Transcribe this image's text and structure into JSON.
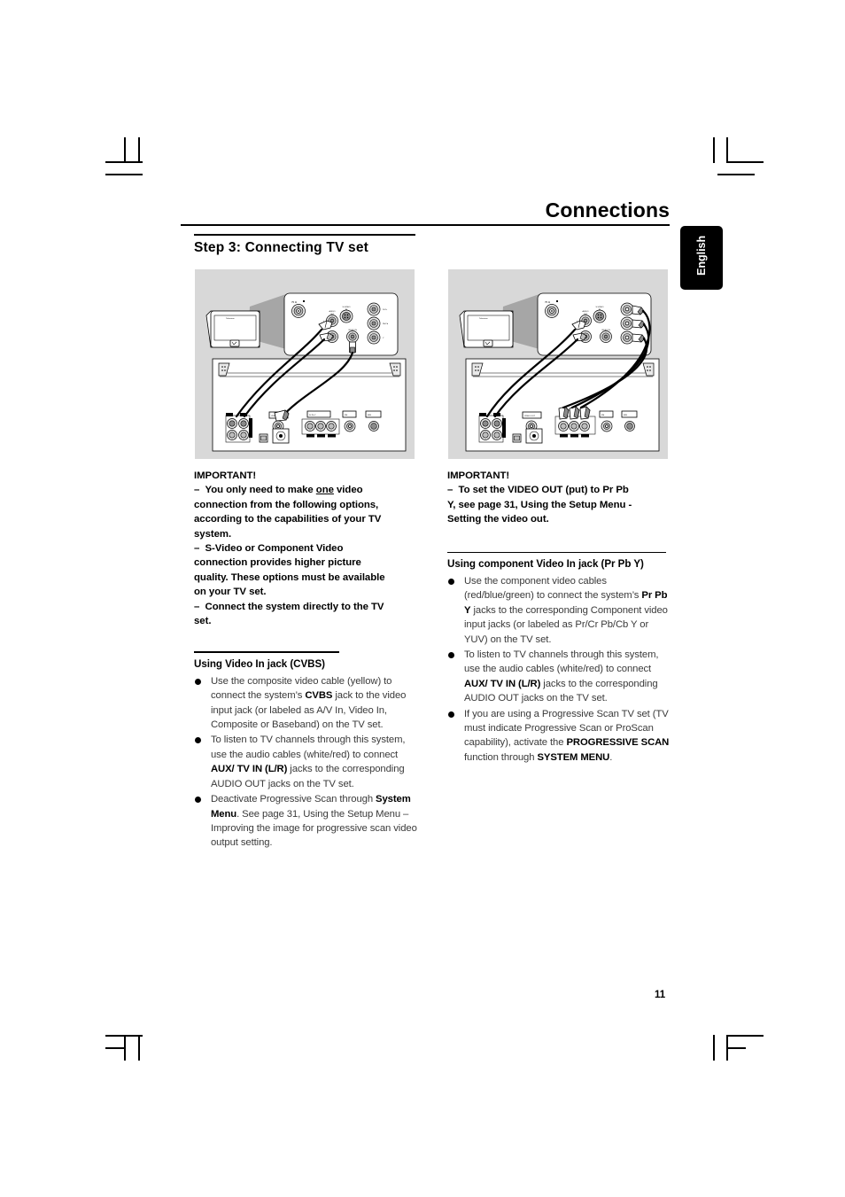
{
  "page": {
    "title": "Connections",
    "number": "11",
    "side_tab": "English",
    "step_heading": "Step 3:  Connecting TV set"
  },
  "left_column": {
    "important_label": "IMPORTANT!",
    "important_lines": [
      "–  You only need to make one video",
      "connection from the following options,",
      "according to the capabilities of your TV",
      "system.",
      "–  S-Video or Component Video",
      "connection provides higher picture",
      "quality. These options must be available",
      "on your TV set.",
      "–  Connect the system directly to the TV",
      "set."
    ],
    "section_heading": "Using Video In jack (CVBS)",
    "bullets": [
      {
        "parts": [
          {
            "t": "Use the composite video cable (yellow) to connect the system’s ",
            "b": false
          },
          {
            "t": "CVBS",
            "b": true
          },
          {
            "t": " jack to the video input jack (or labeled as A/V In, Video In, Composite or Baseband) on the TV set.",
            "b": false
          }
        ]
      },
      {
        "parts": [
          {
            "t": "To listen to TV channels through this system, use the audio cables (white/red) to connect ",
            "b": false
          },
          {
            "t": "AUX/ TV IN (L/R)",
            "b": true
          },
          {
            "t": " jacks to the corresponding AUDIO OUT jacks on the TV set.",
            "b": false
          }
        ]
      },
      {
        "parts": [
          {
            "t": "Deactivate Progressive Scan through ",
            "b": false
          },
          {
            "t": "System Menu",
            "b": true
          },
          {
            "t": ". See page 31, Using the Setup Menu – Improving the image for progressive scan video output setting.",
            "b": false
          }
        ]
      }
    ]
  },
  "right_column": {
    "important_label": "IMPORTANT!",
    "important_lines": [
      "–  To set the VIDEO OUT (put) to Pr Pb",
      "Y, see page 31, Using the Setup Menu -",
      "Setting the video out."
    ],
    "section_heading": "Using component Video In jack (Pr Pb Y)",
    "bullets": [
      {
        "parts": [
          {
            "t": "Use the component video cables (red/blue/green) to connect the system’s ",
            "b": false
          },
          {
            "t": "Pr Pb Y",
            "b": true
          },
          {
            "t": " jacks to the corresponding Component video input jacks (or labeled as Pr/Cr Pb/Cb Y or YUV) on the TV set.",
            "b": false
          }
        ]
      },
      {
        "parts": [
          {
            "t": "To listen to TV channels through this system, use the audio cables (white/red) to connect ",
            "b": false
          },
          {
            "t": "AUX/ TV IN (L/R)",
            "b": true
          },
          {
            "t": " jacks to the corresponding AUDIO OUT jacks on the TV set.",
            "b": false
          }
        ]
      },
      {
        "parts": [
          {
            "t": "If you are using a Progressive Scan TV set (TV must indicate Progressive Scan or ProScan capability), activate the ",
            "b": false
          },
          {
            "t": "PROGRESSIVE SCAN",
            "b": true
          },
          {
            "t": " function through ",
            "b": false
          },
          {
            "t": "SYSTEM MENU",
            "b": true
          },
          {
            "t": ".",
            "b": false
          }
        ]
      }
    ]
  },
  "figures": {
    "left": {
      "caption_alt": "Composite CVBS video connection diagram",
      "tv_label": "Television",
      "panel_labels": {
        "antenna": "75 Ω",
        "audio_out": "AUDIO OUT",
        "audio_l": "L",
        "audio_r": "R",
        "svideo_in": "S-VIDEO IN",
        "video_in": "VIDEO IN",
        "pr": "Pr/Cr",
        "pb": "Pb/Cb",
        "y": "Y"
      },
      "system_labels": {
        "video_out": "VIDEO OUT",
        "component": "Pr Pb Y",
        "scart": "SCART",
        "fm": "FM",
        "mw": "MW",
        "aux_l": "L",
        "aux_r": "R"
      }
    },
    "right": {
      "caption_alt": "Component Pr Pb Y video connection diagram",
      "tv_label": "Television",
      "panel_labels": {
        "antenna": "75 Ω",
        "audio_out": "AUDIO OUT",
        "audio_l": "L",
        "audio_r": "R",
        "svideo_in": "S-VIDEO IN",
        "video_in": "VIDEO IN",
        "pr": "Pr/Cr",
        "pb": "Pb/Cb",
        "y": "Y"
      },
      "system_labels": {
        "video_out": "VIDEO OUT",
        "component": "Pr Pb Y",
        "scart": "SCART",
        "fm": "FM",
        "mw": "MW",
        "aux_l": "L",
        "aux_r": "R"
      }
    }
  }
}
